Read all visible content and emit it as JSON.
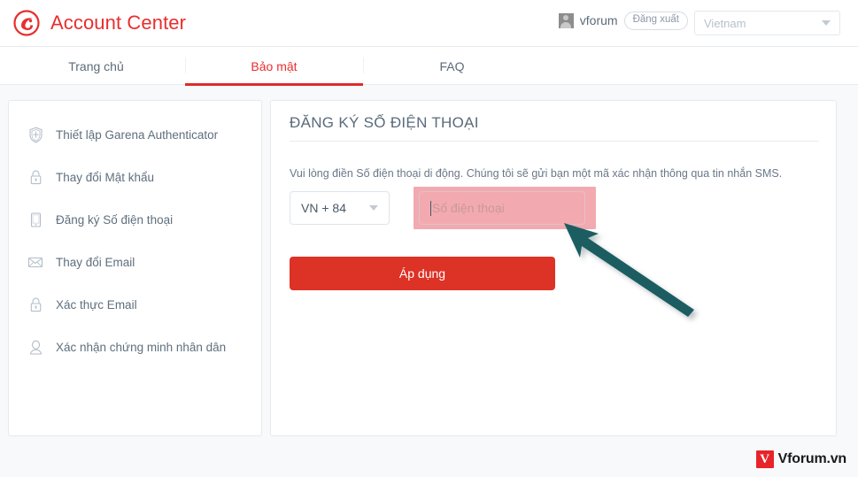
{
  "header": {
    "logo_icon": "garena-logo-icon",
    "title": "Account Center",
    "username": "vforum",
    "avatar_icon": "user-avatar-icon",
    "logout_label": "Đăng xuất",
    "country_selected": "Vietnam",
    "country_caret_icon": "chevron-down-icon"
  },
  "nav": {
    "tabs": [
      {
        "label": "Trang chủ",
        "active": false
      },
      {
        "label": "Bảo mật",
        "active": true
      },
      {
        "label": "FAQ",
        "active": false
      }
    ],
    "active_color": "#e02c2c"
  },
  "sidebar": {
    "items": [
      {
        "label": "Thiết lập Garena Authenticator",
        "icon": "shield-icon"
      },
      {
        "label": "Thay đổi Mật khẩu",
        "icon": "lock-icon"
      },
      {
        "label": "Đăng ký Số điện thoại",
        "icon": "mobile-phone-icon"
      },
      {
        "label": "Thay đổi Email",
        "icon": "envelope-icon"
      },
      {
        "label": "Xác thực Email",
        "icon": "lock-icon"
      },
      {
        "label": "Xác nhận chứng minh nhân dân",
        "icon": "person-id-icon"
      }
    ]
  },
  "content": {
    "title": "ĐĂNG KÝ SỐ ĐIỆN THOẠI",
    "description": "Vui lòng điền Số điện thoại di động. Chúng tôi sẽ gửi bạn một mã xác nhận thông qua tin nhắn SMS.",
    "country_code_value": "VN + 84",
    "country_code_caret_icon": "chevron-down-icon",
    "phone_placeholder": "Số điện thoại",
    "phone_value": "",
    "apply_label": "Áp dụng",
    "apply_color": "#dd3226",
    "highlight_color": "#f2aab0"
  },
  "annotation": {
    "arrow_icon": "pointer-arrow-icon",
    "arrow_color": "#1a5d62"
  },
  "footer": {
    "watermark_mark": "V",
    "watermark_text": "Vforum.vn",
    "watermark_color": "#e8232a"
  }
}
